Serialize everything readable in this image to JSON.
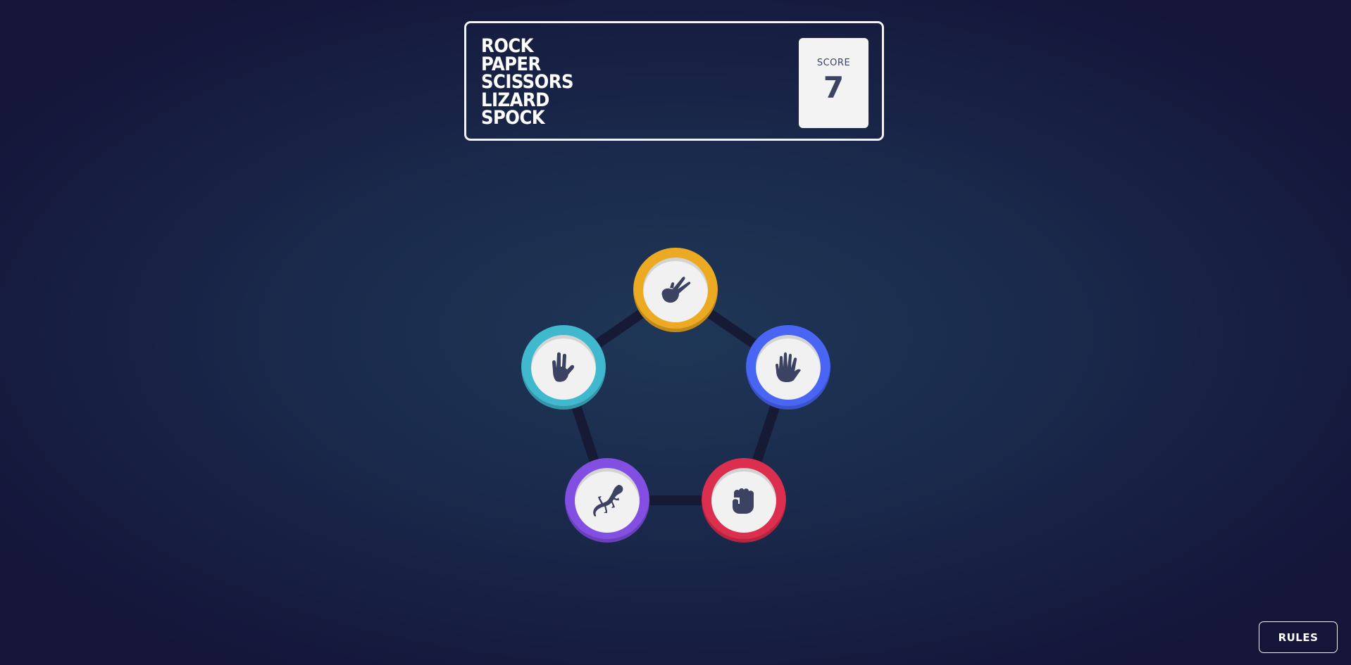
{
  "header": {
    "title_lines": [
      "ROCK",
      "PAPER",
      "SCISSORS",
      "LIZARD",
      "SPOCK"
    ],
    "score_label": "SCORE",
    "score_value": "7"
  },
  "tokens": [
    {
      "name": "scissors",
      "icon": "scissors-hand-icon",
      "color": "#eca922"
    },
    {
      "name": "paper",
      "icon": "paper-hand-icon",
      "color": "#4865f4"
    },
    {
      "name": "rock",
      "icon": "rock-fist-icon",
      "color": "#dc2e4e"
    },
    {
      "name": "lizard",
      "icon": "lizard-icon",
      "color": "#834fe3"
    },
    {
      "name": "spock",
      "icon": "spock-hand-icon",
      "color": "#40b9ce"
    }
  ],
  "colors": {
    "background_center": "#1f3756",
    "background_edge": "#141539",
    "text_dark": "#3b4262",
    "pentagon_line": "#161a35"
  },
  "footer": {
    "rules_label": "RULES"
  }
}
